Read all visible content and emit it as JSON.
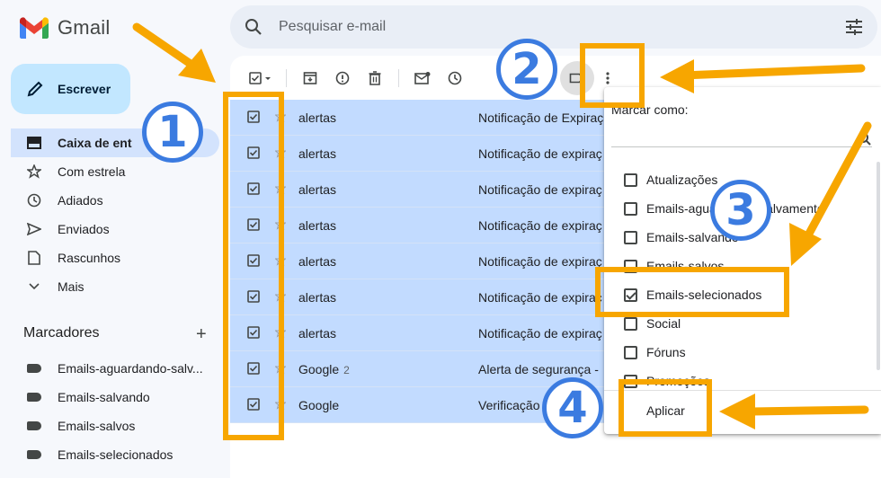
{
  "app": {
    "title": "Gmail"
  },
  "search": {
    "placeholder": "Pesquisar e-mail"
  },
  "compose": {
    "label": "Escrever"
  },
  "nav": [
    {
      "label": "Caixa de ent",
      "icon": "inbox-icon",
      "active": true
    },
    {
      "label": "Com estrela",
      "icon": "star-icon"
    },
    {
      "label": "Adiados",
      "icon": "clock-icon"
    },
    {
      "label": "Enviados",
      "icon": "send-icon"
    },
    {
      "label": "Rascunhos",
      "icon": "draft-icon"
    },
    {
      "label": "Mais",
      "icon": "chevron-down-icon"
    }
  ],
  "labels": {
    "title": "Marcadores",
    "add": "+",
    "items": [
      "Emails-aguardando-salv...",
      "Emails-salvando",
      "Emails-salvos",
      "Emails-selecionados"
    ]
  },
  "emails": [
    {
      "sender": "alertas",
      "count": "",
      "subject": "Notificação de Expiraç"
    },
    {
      "sender": "alertas",
      "count": "",
      "subject": "Notificação de expiraç"
    },
    {
      "sender": "alertas",
      "count": "",
      "subject": "Notificação de expiraç"
    },
    {
      "sender": "alertas",
      "count": "",
      "subject": "Notificação de expiraç"
    },
    {
      "sender": "alertas",
      "count": "",
      "subject": "Notificação de expiraç"
    },
    {
      "sender": "alertas",
      "count": "",
      "subject": "Notificação de expiraç"
    },
    {
      "sender": "alertas",
      "count": "",
      "subject": "Notificação de expiraç"
    },
    {
      "sender": "Google",
      "count": "2",
      "subject": "Alerta de segurança -"
    },
    {
      "sender": "Google",
      "count": "",
      "subject": "Verificação"
    }
  ],
  "label_menu": {
    "title": "Marcar como:",
    "items": [
      {
        "label": "Atualizações",
        "checked": false
      },
      {
        "label": "Emails-aguardando-salvamento",
        "checked": false
      },
      {
        "label": "Emails-salvando",
        "checked": false
      },
      {
        "label": "Emails-salvos",
        "checked": false
      },
      {
        "label": "Emails-selecionados",
        "checked": true
      },
      {
        "label": "Social",
        "checked": false
      },
      {
        "label": "Fóruns",
        "checked": false
      },
      {
        "label": "Promoções",
        "checked": false
      }
    ],
    "apply": "Aplicar"
  },
  "annotations": {
    "steps": [
      "1",
      "2",
      "3",
      "4"
    ],
    "highlight_color": "#f7a600",
    "circle_color": "#3b7be0"
  },
  "colors": {
    "selected_row": "#c2dbff",
    "compose": "#c2e7ff",
    "nav_active": "#d3e3fd"
  }
}
